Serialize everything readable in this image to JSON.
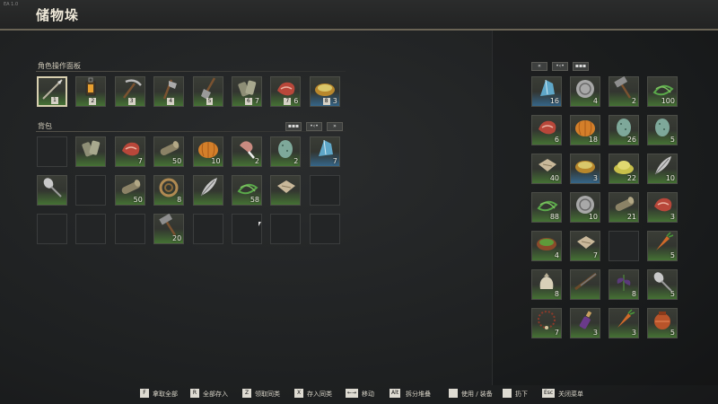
{
  "title": "储物垛",
  "version": "EA 1.0",
  "quickbar": {
    "label": "角色操作面板",
    "slots": [
      {
        "icon": "spear-icon",
        "hotkey": "1",
        "count": ""
      },
      {
        "icon": "lantern-icon",
        "hotkey": "2",
        "count": ""
      },
      {
        "icon": "pickaxe-icon",
        "hotkey": "3",
        "count": ""
      },
      {
        "icon": "axe-icon",
        "hotkey": "4",
        "count": ""
      },
      {
        "icon": "shovel-icon",
        "hotkey": "5",
        "count": ""
      },
      {
        "icon": "bandage-icon",
        "hotkey": "6",
        "count": "7"
      },
      {
        "icon": "raw-meat-icon",
        "hotkey": "7",
        "count": "6"
      },
      {
        "icon": "food-bowl-icon",
        "hotkey": "8",
        "count": "3"
      }
    ]
  },
  "backpack": {
    "label": "背包",
    "slots": [
      {
        "icon": "",
        "count": ""
      },
      {
        "icon": "bandage-icon",
        "count": ""
      },
      {
        "icon": "raw-meat-icon",
        "count": "7"
      },
      {
        "icon": "log-icon",
        "count": "50"
      },
      {
        "icon": "pumpkin-icon",
        "count": "10"
      },
      {
        "icon": "meat-leg-icon",
        "count": "2"
      },
      {
        "icon": "egg-icon",
        "count": "2"
      },
      {
        "icon": "crystal-icon",
        "count": "7"
      },
      {
        "icon": "spoon-icon",
        "count": ""
      },
      {
        "icon": "",
        "count": ""
      },
      {
        "icon": "log-icon",
        "count": "50"
      },
      {
        "icon": "rope-icon",
        "count": "8"
      },
      {
        "icon": "feather-icon",
        "count": ""
      },
      {
        "icon": "fiber-icon",
        "count": "58"
      },
      {
        "icon": "cloth-icon",
        "count": ""
      },
      {
        "icon": "",
        "count": ""
      },
      {
        "icon": "",
        "count": ""
      },
      {
        "icon": "",
        "count": ""
      },
      {
        "icon": "",
        "count": ""
      },
      {
        "icon": "hammer-icon",
        "count": "20"
      },
      {
        "icon": "",
        "count": ""
      },
      {
        "icon": "",
        "count": ""
      },
      {
        "icon": "",
        "count": ""
      },
      {
        "icon": "",
        "count": ""
      }
    ]
  },
  "storage": {
    "buttons": [
      "«",
      "•‹•",
      "▪▪▪"
    ],
    "slots": [
      {
        "icon": "crystal-icon",
        "count": "16"
      },
      {
        "icon": "coin-icon",
        "count": "4"
      },
      {
        "icon": "hammer-icon",
        "count": "2"
      },
      {
        "icon": "fiber-icon",
        "count": "100"
      },
      {
        "icon": "raw-meat-icon",
        "count": "6"
      },
      {
        "icon": "pumpkin-icon",
        "count": "18"
      },
      {
        "icon": "egg-icon",
        "count": "26"
      },
      {
        "icon": "egg-icon",
        "count": "5"
      },
      {
        "icon": "cloth-icon",
        "count": "40"
      },
      {
        "icon": "food-bowl-icon",
        "count": "3"
      },
      {
        "icon": "grain-icon",
        "count": "22"
      },
      {
        "icon": "feather-icon",
        "count": "10"
      },
      {
        "icon": "fiber-icon",
        "count": "88"
      },
      {
        "icon": "coin-icon",
        "count": "10"
      },
      {
        "icon": "log-icon",
        "count": "21"
      },
      {
        "icon": "raw-meat-icon",
        "count": "3"
      },
      {
        "icon": "salad-bowl-icon",
        "count": "4"
      },
      {
        "icon": "cloth-icon",
        "count": "7"
      },
      {
        "icon": "",
        "count": ""
      },
      {
        "icon": "carrot-icon",
        "count": "5"
      },
      {
        "icon": "sack-icon",
        "count": "8"
      },
      {
        "icon": "rifle-icon",
        "count": ""
      },
      {
        "icon": "herb-icon",
        "count": "8"
      },
      {
        "icon": "spoon-icon",
        "count": "5"
      },
      {
        "icon": "necklace-icon",
        "count": "7"
      },
      {
        "icon": "potion-icon",
        "count": "3"
      },
      {
        "icon": "carrot-icon",
        "count": "3"
      },
      {
        "icon": "jar-icon",
        "count": "5"
      }
    ]
  },
  "backpack_buttons": [
    "▪▪▪",
    "•‹•",
    "»"
  ],
  "footer": [
    {
      "key": "F",
      "label": "拿取全部"
    },
    {
      "key": "R",
      "label": "全部存入"
    },
    {
      "key": "Z",
      "label": "领取同类"
    },
    {
      "key": "X",
      "label": "存入同类"
    },
    {
      "key": "←→",
      "label": "移动"
    },
    {
      "key": "Alt",
      "label": "拆分堆叠"
    },
    {
      "key": "",
      "label": "使用 / 装备"
    },
    {
      "key": "",
      "label": "扔下"
    },
    {
      "key": "Esc",
      "label": "关闭菜单"
    }
  ],
  "colors": {
    "rarity_green": "#5aaa3c",
    "rarity_blue": "#3c8cc8",
    "background": "#1f2122"
  }
}
